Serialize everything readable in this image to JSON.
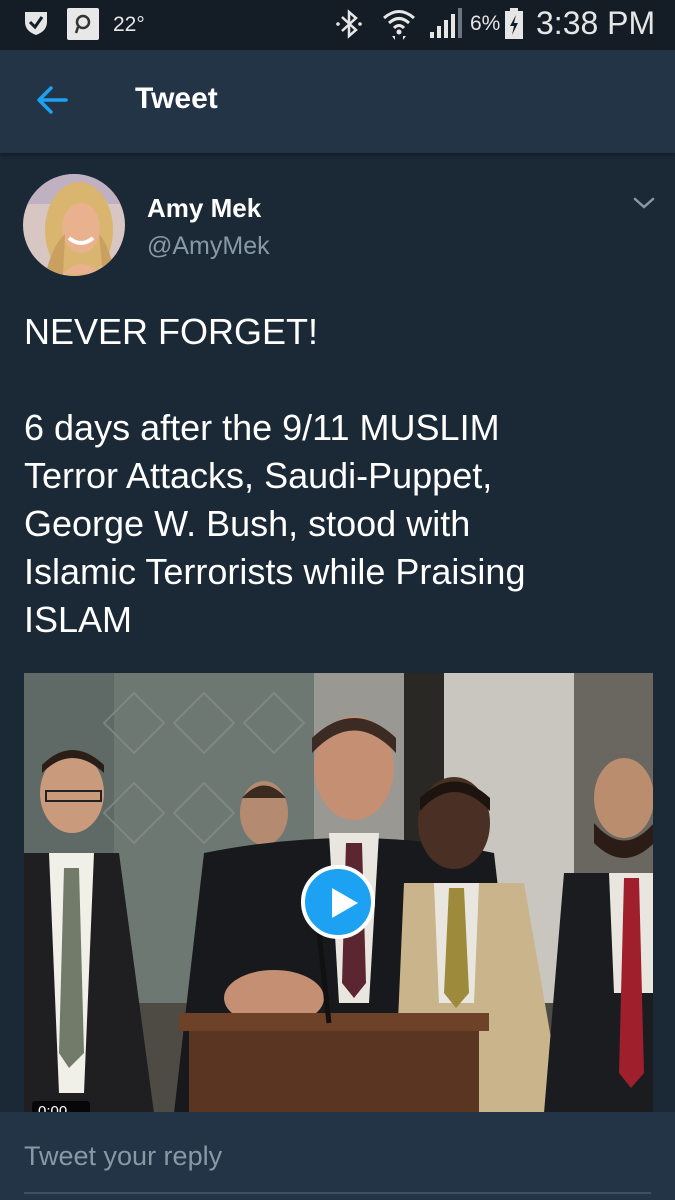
{
  "status_bar": {
    "temperature": "22°",
    "battery_percent": "6%",
    "time": "3:38 PM"
  },
  "header": {
    "back_icon": "back-arrow-icon",
    "title": "Tweet"
  },
  "tweet": {
    "author_name": "Amy Mek",
    "author_handle": "@AmyMek",
    "lines": [
      "NEVER FORGET!",
      "",
      "6 days after the 9/11 MUSLIM",
      "Terror Attacks, Saudi-Puppet,",
      "George W. Bush, stood with",
      "Islamic Terrorists while Praising",
      "ISLAM"
    ],
    "media": {
      "type": "video",
      "duration": "0:00"
    }
  },
  "reply": {
    "placeholder": "Tweet your reply"
  },
  "colors": {
    "background": "#1b2836",
    "header": "#243447",
    "accent": "#1da1f2",
    "muted_text": "#8899a6"
  }
}
